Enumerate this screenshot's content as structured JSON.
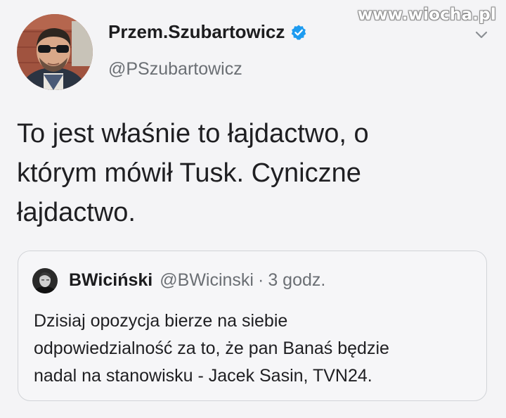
{
  "watermark": "www.wiocha.pl",
  "tweet": {
    "author": {
      "display_name": "Przem.Szubartowicz",
      "handle": "@PSzubartowicz",
      "verified": true,
      "avatar_icon": "profile-photo"
    },
    "text_lines": [
      "To jest właśnie to łajdactwo, o",
      "którym mówił Tusk. Cyniczne",
      "łajdactwo."
    ],
    "quoted": {
      "display_name": "BWiciński",
      "handle": "@BWicinski",
      "separator": "·",
      "time": "3 godz.",
      "avatar_icon": "profile-photo",
      "text_lines": [
        "Dzisiaj opozycja bierze na siebie",
        "odpowiedzialność za to, że pan Banaś będzie",
        "nadal na stanowisku - Jacek Sasin, TVN24."
      ]
    }
  },
  "colors": {
    "background": "#f4f4f6",
    "verified_blue": "#1d9bf0",
    "secondary_text": "#6b6f74",
    "card_border": "#d2d4d8"
  },
  "icons": {
    "menu": "chevron-down-icon",
    "verified": "verified-badge-icon"
  }
}
